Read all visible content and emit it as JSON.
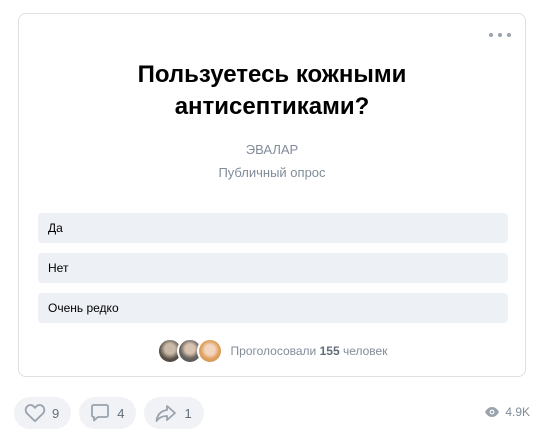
{
  "poll": {
    "title": "Пользуетесь кожными антисептиками?",
    "author": "ЭВАЛАР",
    "type": "Публичный опрос",
    "options": [
      "Да",
      "Нет",
      "Очень редко"
    ],
    "voters_prefix": "Проголосовали",
    "voters_count": "155",
    "voters_suffix": "человек"
  },
  "actions": {
    "likes": "9",
    "comments": "4",
    "shares": "1",
    "views": "4.9K"
  },
  "icons": {
    "more": "more-horizontal-icon",
    "like": "heart-icon",
    "comment": "comment-icon",
    "share": "share-icon",
    "views": "eye-icon"
  },
  "colors": {
    "option_bg": "#edf0f4",
    "secondary_text": "#818c99",
    "icon": "#99a2ad"
  }
}
